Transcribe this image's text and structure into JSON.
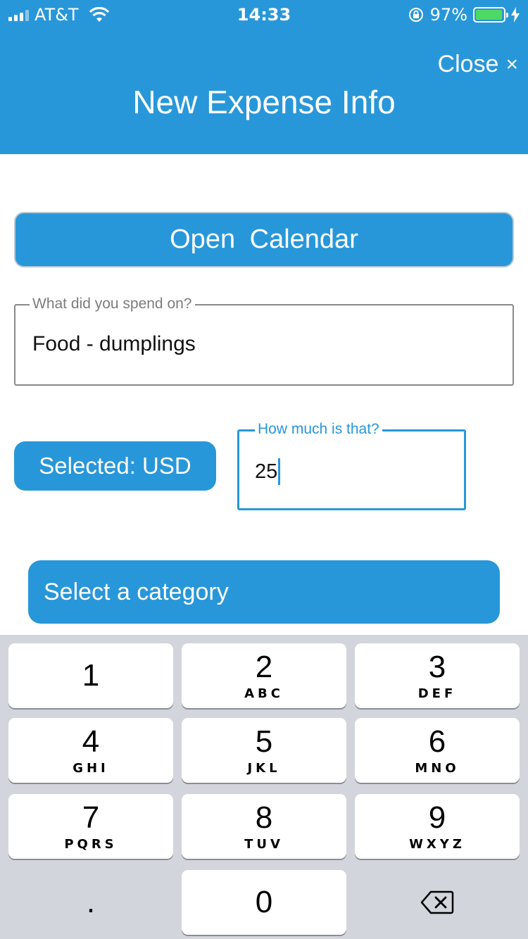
{
  "status_bar": {
    "carrier": "AT&T",
    "time": "14:33",
    "battery": "97%",
    "battery_level": 0.97
  },
  "header": {
    "close_label": "Close",
    "close_icon": "×",
    "title": "New Expense Info"
  },
  "form": {
    "calendar_button": "Open  Calendar",
    "spend_label": "What did you spend on?",
    "spend_value": "Food - dumplings",
    "currency_button": "Selected: USD",
    "amount_label": "How much is that?",
    "amount_value": "25",
    "category_button": "Select a category"
  },
  "keyboard": {
    "keys": [
      {
        "num": "1",
        "letters": ""
      },
      {
        "num": "2",
        "letters": "ABC"
      },
      {
        "num": "3",
        "letters": "DEF"
      },
      {
        "num": "4",
        "letters": "GHI"
      },
      {
        "num": "5",
        "letters": "JKL"
      },
      {
        "num": "6",
        "letters": "MNO"
      },
      {
        "num": "7",
        "letters": "PQRS"
      },
      {
        "num": "8",
        "letters": "TUV"
      },
      {
        "num": "9",
        "letters": "WXYZ"
      },
      {
        "num": ".",
        "letters": ""
      },
      {
        "num": "0",
        "letters": ""
      }
    ],
    "delete_icon": "backspace-icon"
  }
}
